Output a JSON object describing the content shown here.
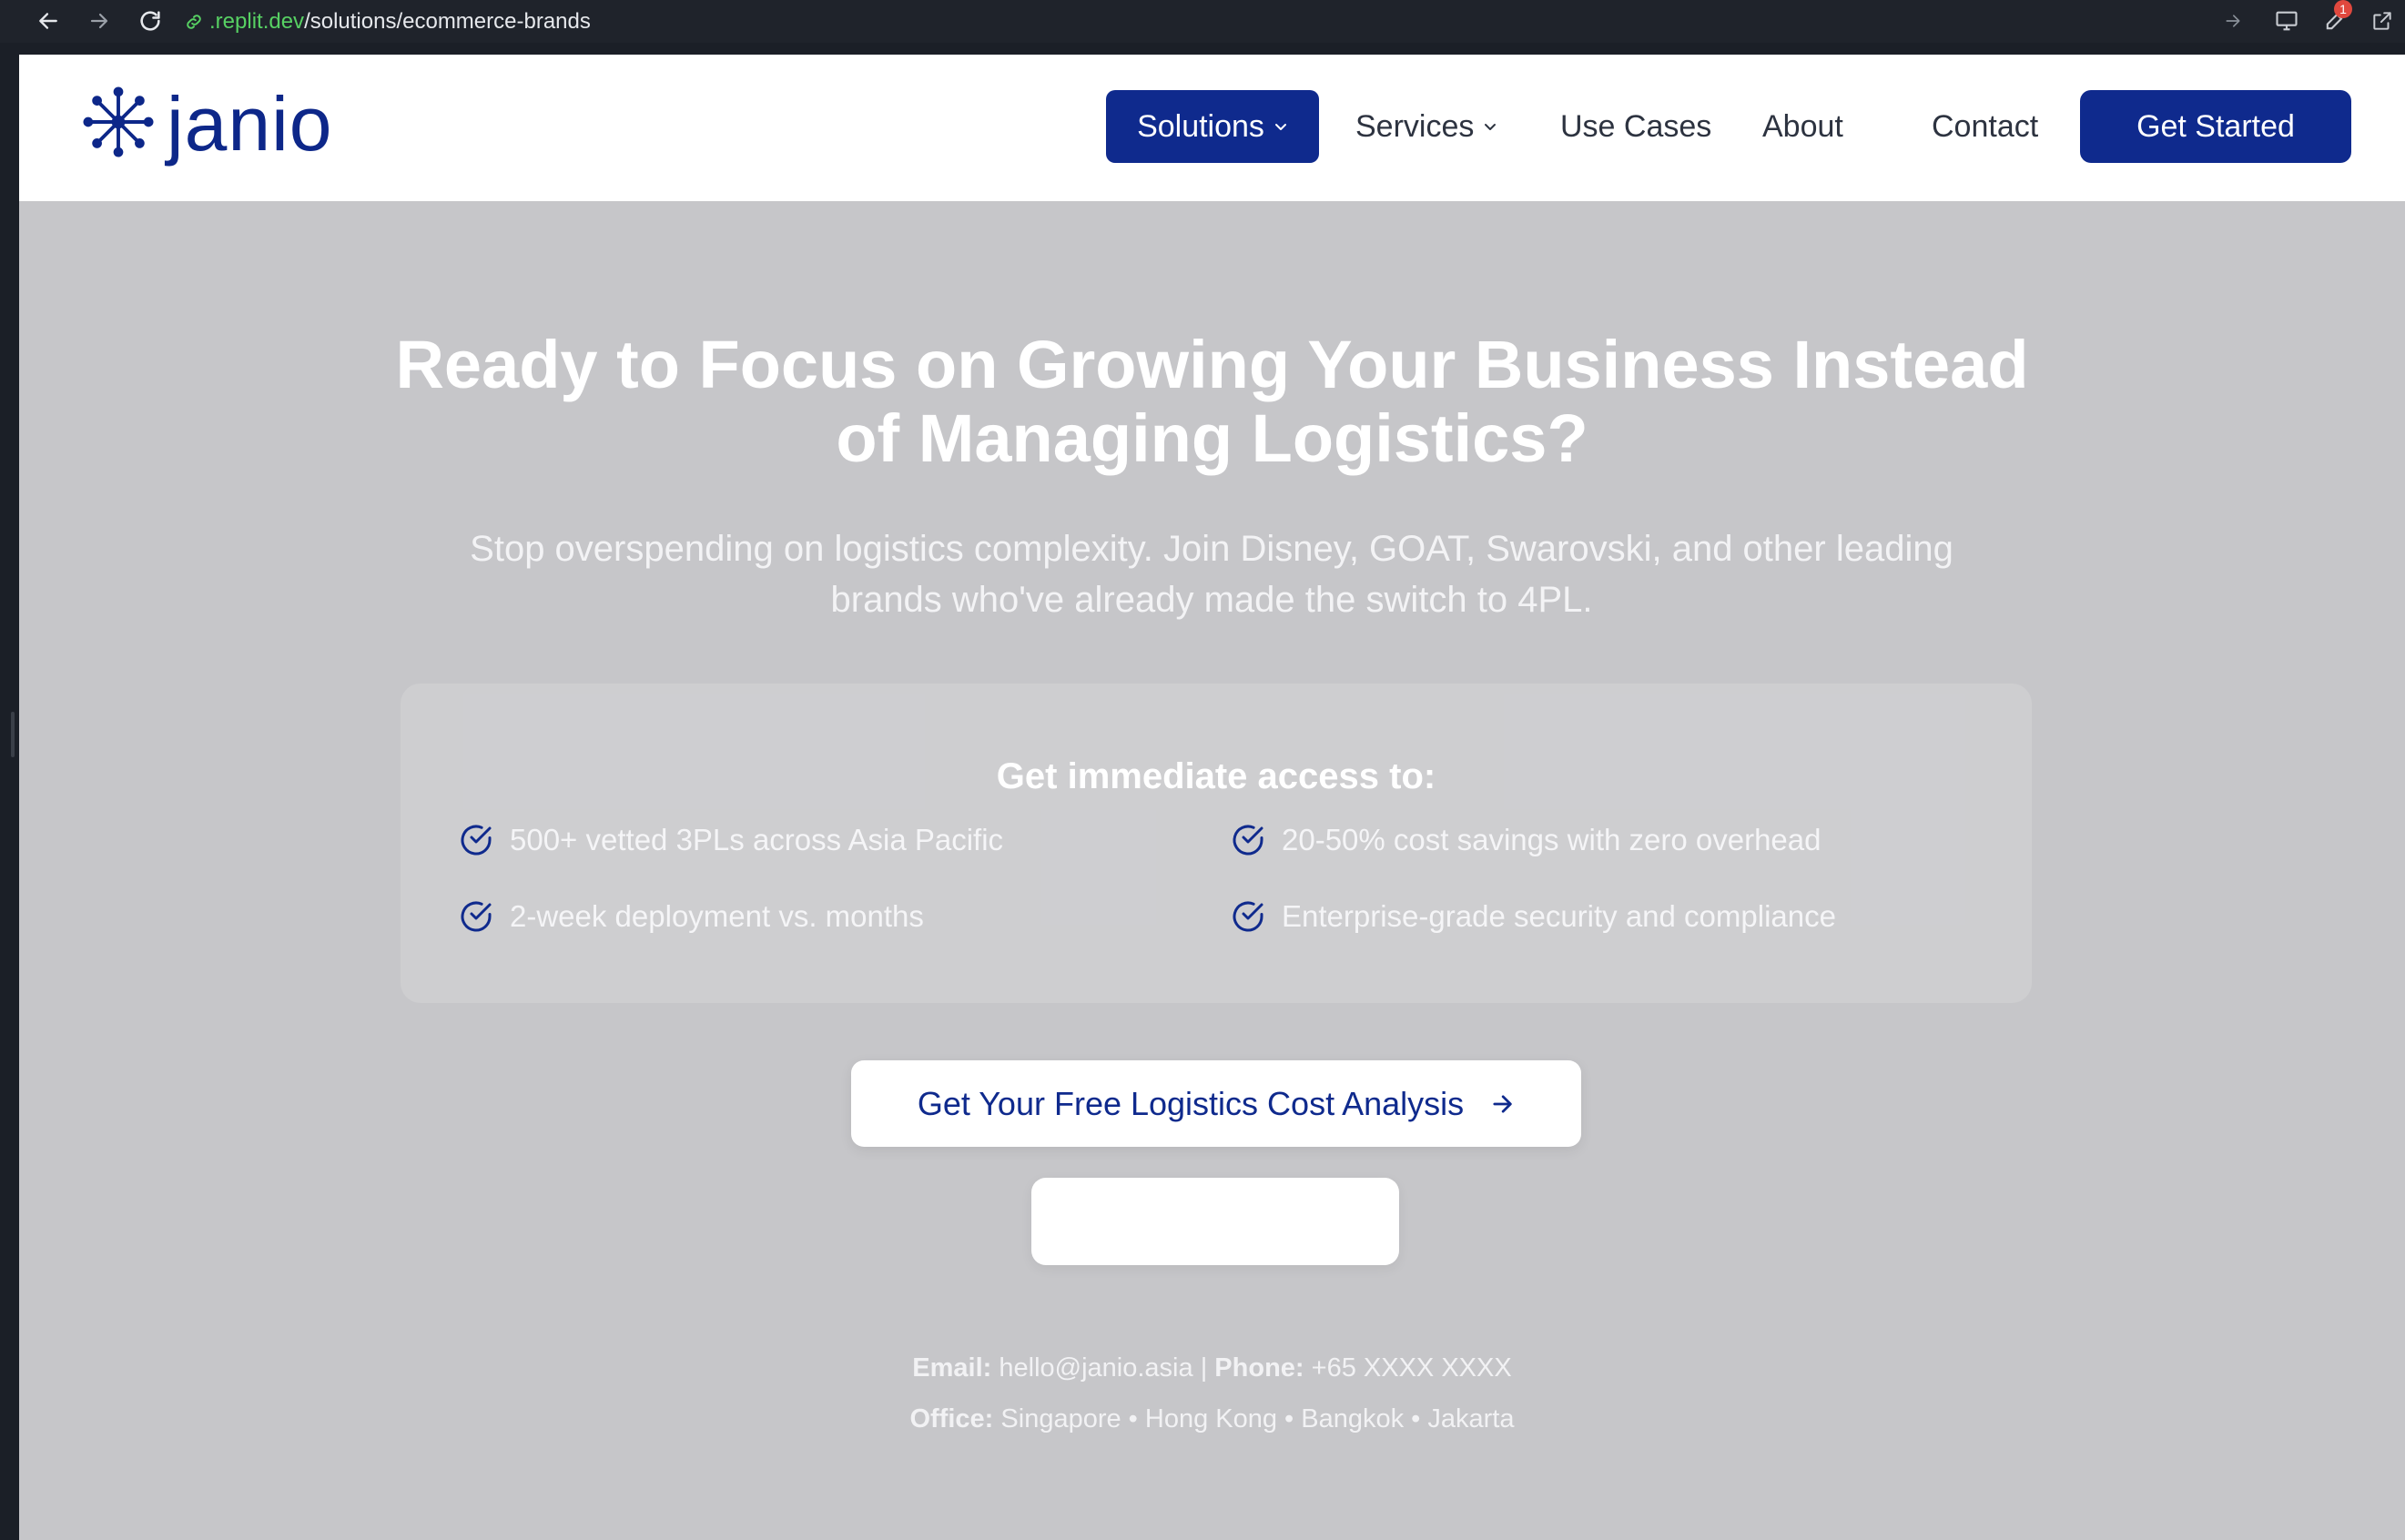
{
  "browser": {
    "url_host": ".replit.dev",
    "url_path": "/solutions/ecommerce-brands",
    "extensions_badge": "1"
  },
  "header": {
    "logo_text": "janio",
    "nav": {
      "solutions": "Solutions",
      "services": "Services",
      "use_cases": "Use Cases",
      "about": "About",
      "contact": "Contact",
      "cta": "Get Started"
    }
  },
  "hero": {
    "title_line1": "Ready to Focus on Growing Your Business Instead",
    "title_line2": "of Managing Logistics?",
    "subtitle_line1": "Stop overspending on logistics complexity. Join Disney, GOAT, Swarovski, and other leading",
    "subtitle_line2": "brands who've already made the switch to 4PL."
  },
  "access": {
    "title": "Get immediate access to:",
    "benefits": [
      "500+ vetted 3PLs across Asia Pacific",
      "20-50% cost savings with zero overhead",
      "2-week deployment vs. months",
      "Enterprise-grade security and compliance"
    ]
  },
  "cta": {
    "primary": "Get Your Free Logistics Cost Analysis",
    "secondary": ""
  },
  "contact": {
    "email_label": "Email:",
    "email": "hello@janio.asia",
    "separator": "|",
    "phone_label": "Phone:",
    "phone": "+65 XXXX XXXX",
    "office_label": "Office:",
    "offices": "Singapore • Hong Kong • Bangkok • Jakarta"
  },
  "colors": {
    "brand": "#0f2a8d",
    "overlay": "#c6c6c9"
  }
}
